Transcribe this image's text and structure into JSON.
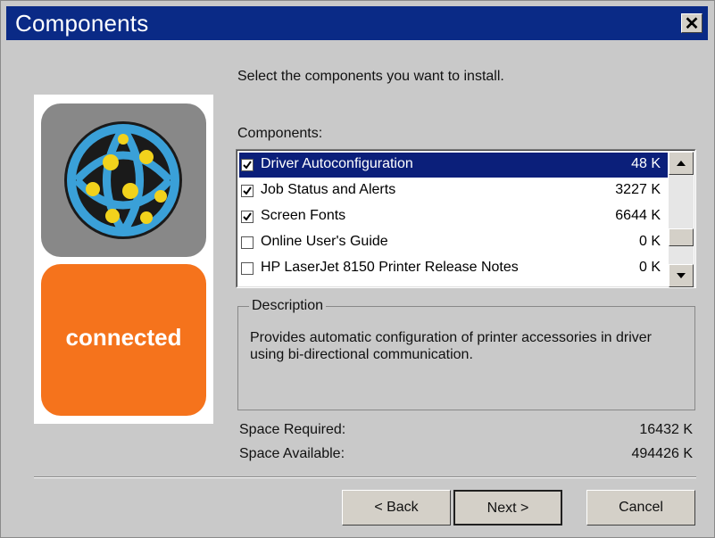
{
  "dialog": {
    "title": "Components",
    "close_glyph": "✕",
    "instruction": "Select the components you want to install.",
    "components_label": "Components:",
    "brand_word": "connected",
    "brand_color": "#f5731c",
    "components": [
      {
        "name": "Driver Autoconfiguration",
        "size": "48 K",
        "checked": true,
        "selected": true
      },
      {
        "name": "Job Status and Alerts",
        "size": "3227 K",
        "checked": true,
        "selected": false
      },
      {
        "name": "Screen Fonts",
        "size": "6644 K",
        "checked": true,
        "selected": false
      },
      {
        "name": "Online User's Guide",
        "size": "0 K",
        "checked": false,
        "selected": false
      },
      {
        "name": "HP LaserJet 8150 Printer Release Notes",
        "size": "0 K",
        "checked": false,
        "selected": false
      }
    ],
    "description_title": "Description",
    "description_text": "Provides automatic configuration of printer accessories in driver using bi-directional communication.",
    "space_required_label": "Space Required:",
    "space_required_value": "16432 K",
    "space_available_label": "Space Available:",
    "space_available_value": "494426 K",
    "buttons": {
      "back": "< Back",
      "next": "Next >",
      "cancel": "Cancel"
    },
    "icons": {
      "globe": "network-globe-icon",
      "scroll_up": "arrow-up-icon",
      "scroll_down": "arrow-down-icon"
    }
  }
}
